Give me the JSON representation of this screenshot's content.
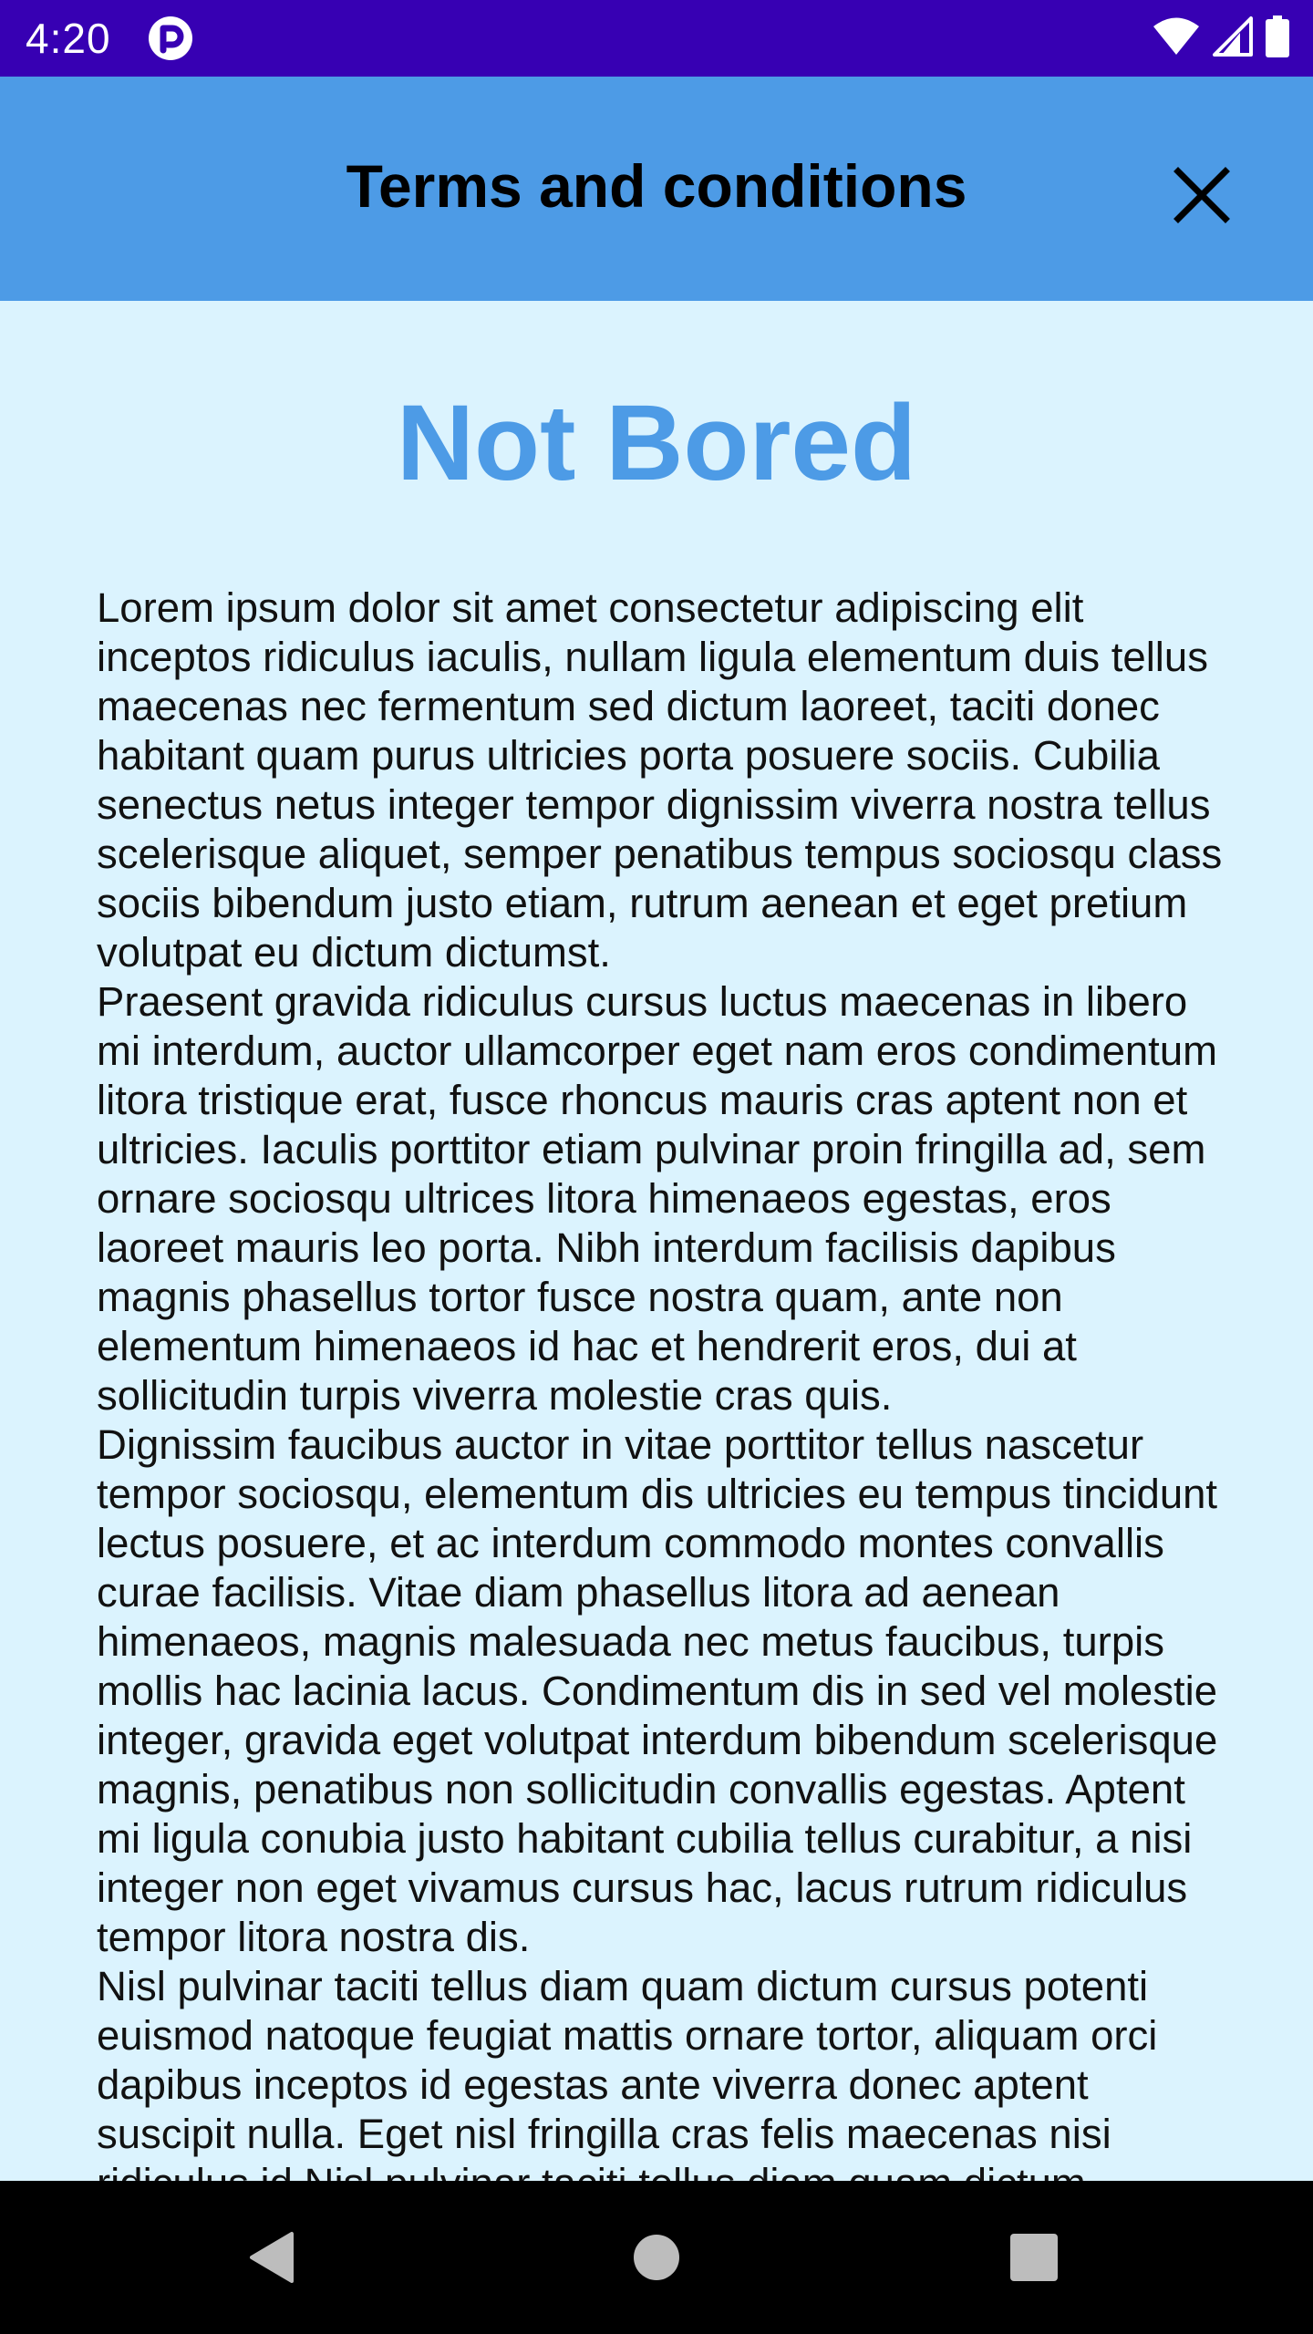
{
  "status_bar": {
    "time": "4:20",
    "app_icon": "app-notification-icon",
    "wifi_icon": "wifi-icon",
    "signal_icon": "signal-icon",
    "battery_icon": "battery-icon"
  },
  "app_bar": {
    "title": "Terms and conditions",
    "close_icon": "close-icon",
    "background_color": "#4d9be6"
  },
  "content": {
    "heading": "Not Bored",
    "heading_color": "#4d9be6",
    "background_color": "#dbf3fe",
    "body": "Lorem ipsum dolor sit amet consectetur adipiscing elit inceptos ridiculus iaculis, nullam ligula elementum duis tellus maecenas nec fermentum sed dictum laoreet, taciti donec habitant quam purus ultricies porta posuere sociis. Cubilia senectus netus integer tempor dignissim viverra nostra tellus scelerisque aliquet, semper penatibus tempus sociosqu class sociis bibendum justo etiam, rutrum aenean et eget pretium volutpat eu dictum dictumst.\n Praesent gravida ridiculus cursus luctus maecenas in libero mi interdum, auctor ullamcorper eget nam eros condimentum litora tristique erat, fusce rhoncus mauris cras aptent non et ultricies. Iaculis porttitor etiam pulvinar proin fringilla ad, sem ornare sociosqu ultrices litora himenaeos egestas, eros laoreet mauris leo porta. Nibh interdum facilisis dapibus magnis phasellus tortor fusce nostra quam, ante non elementum himenaeos id hac et hendrerit eros, dui at sollicitudin turpis viverra molestie cras quis.\n Dignissim faucibus auctor in vitae porttitor tellus nascetur tempor sociosqu, elementum dis ultricies eu tempus tincidunt lectus posuere, et ac interdum commodo montes convallis curae facilisis. Vitae diam phasellus litora ad aenean himenaeos, magnis malesuada nec metus faucibus, turpis mollis hac lacinia lacus. Condimentum dis in sed vel molestie integer, gravida eget volutpat interdum bibendum scelerisque magnis, penatibus non sollicitudin convallis egestas. Aptent mi ligula conubia justo habitant cubilia tellus curabitur, a nisi integer non eget vivamus cursus hac, lacus rutrum ridiculus tempor litora nostra dis.\n Nisl pulvinar taciti tellus diam quam dictum cursus potenti euismod natoque feugiat mattis ornare tortor, aliquam orci dapibus inceptos id egestas ante viverra donec aptent suscipit nulla. Eget nisl fringilla cras felis maecenas nisi ridiculus id Nisl pulvinar taciti tellus diam quam dictum"
  },
  "nav_bar": {
    "back_icon": "back-triangle-icon",
    "home_icon": "home-circle-icon",
    "recents_icon": "recents-square-icon"
  }
}
